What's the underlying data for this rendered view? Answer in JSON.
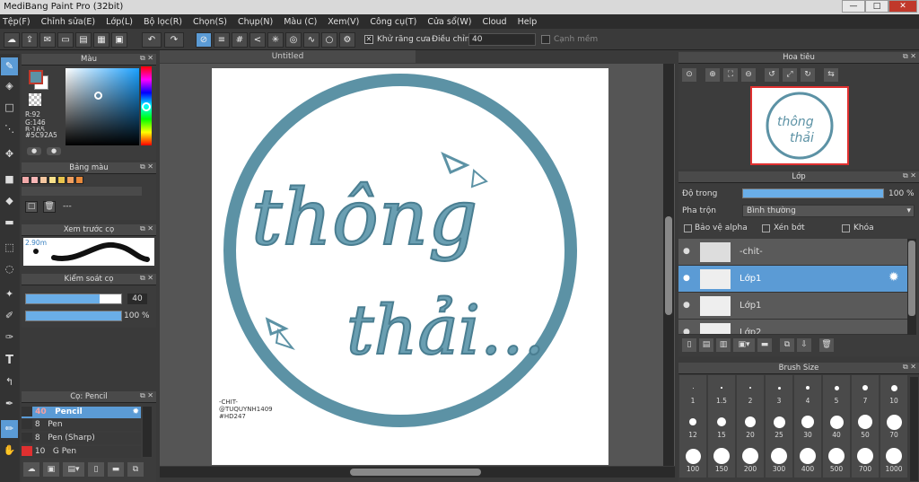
{
  "app": {
    "title": "MediBang Paint Pro (32bit)",
    "min": "—",
    "max": "□",
    "close": "✕"
  },
  "menu": [
    "Tệp(F)",
    "Chỉnh sửa(E)",
    "Lớp(L)",
    "Bộ lọc(R)",
    "Chọn(S)",
    "Chụp(N)",
    "Màu (C)",
    "Xem(V)",
    "Công cụ(T)",
    "Cửa sổ(W)",
    "Cloud",
    "Help"
  ],
  "toolbar": {
    "antialias_label": "Khử răng cưa",
    "correction_label": "Điều chỉnh",
    "correction_value": "40",
    "snap_label": "Cạnh mềm"
  },
  "color_panel": {
    "title": "Màu",
    "r": "R:92",
    "g": "G:146",
    "b": "B:165",
    "hex": "#5C92A5",
    "primary": "#5c92a5",
    "secondary": "#ffffff"
  },
  "palette_panel": {
    "title": "Bảng màu",
    "swatches": [
      "#f2a9a9",
      "#f7b6b6",
      "#f5c7a0",
      "#f7e08a",
      "#e8c44d",
      "#f0a060",
      "#e8893a"
    ],
    "extra": "---"
  },
  "preview_panel": {
    "title": "Xem trước cọ",
    "size": "2.90m"
  },
  "brush_control": {
    "title": "Kiểm soát cọ",
    "size_value": "40",
    "opacity_value": "100 %",
    "size_fraction": 0.77,
    "opacity_fraction": 1.0
  },
  "brush_list": {
    "title": "Cọ: Pencil",
    "items": [
      {
        "size": "40",
        "name": "Pencil",
        "color": "#333333"
      },
      {
        "size": "8",
        "name": "Pen",
        "color": "#333333"
      },
      {
        "size": "8",
        "name": "Pen (Sharp)",
        "color": "#333333"
      },
      {
        "size": "10",
        "name": "G Pen",
        "color": "#e03030"
      }
    ]
  },
  "canvas": {
    "tab": "Untitled",
    "credits": [
      "-CHIT-",
      "@TUQUYNH1409",
      "#HD247"
    ],
    "word1": "thông",
    "word2": "thải..."
  },
  "navigator": {
    "title": "Hoa tiêu"
  },
  "layers": {
    "title": "Lớp",
    "opacity_label": "Độ trong",
    "opacity_value": "100 %",
    "blend_label": "Pha trộn",
    "blend_value": "Bình thường",
    "protect_alpha": "Bảo vệ alpha",
    "clipping": "Xén bớt",
    "lock": "Khóa",
    "items": [
      {
        "name": "-chit-"
      },
      {
        "name": "Lớp1"
      },
      {
        "name": "Lớp1"
      },
      {
        "name": "Lớp2"
      }
    ]
  },
  "brush_size": {
    "title": "Brush Size",
    "sizes": [
      "1",
      "1.5",
      "2",
      "3",
      "4",
      "5",
      "7",
      "10",
      "12",
      "15",
      "20",
      "25",
      "30",
      "40",
      "50",
      "70",
      "100",
      "150",
      "200",
      "300",
      "400",
      "500",
      "700",
      "1000"
    ]
  }
}
